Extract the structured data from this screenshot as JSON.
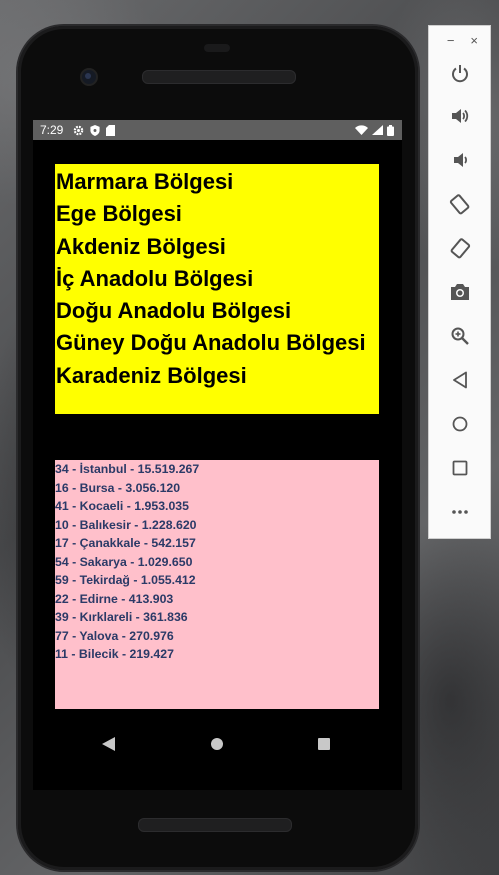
{
  "status_bar": {
    "time": "7:29",
    "left_icons": [
      "gear-icon",
      "shield-icon",
      "sd-card-icon"
    ],
    "right_icons": [
      "wifi-icon",
      "signal-icon",
      "battery-icon"
    ],
    "background": "#5f5f5f"
  },
  "regions": {
    "background": "#ffff00",
    "items": [
      "Marmara Bölgesi",
      "Ege Bölgesi",
      "Akdeniz Bölgesi",
      "İç Anadolu Bölgesi",
      "Doğu Anadolu Bölgesi",
      "Güney Doğu Anadolu Bölgesi",
      "Karadeniz Bölgesi"
    ]
  },
  "cities": {
    "background": "#ffc0cb",
    "text_color": "#2b3a67",
    "items": [
      "34 - İstanbul - 15.519.267",
      "16 - Bursa - 3.056.120",
      "41 - Kocaeli - 1.953.035",
      "10 - Balıkesir - 1.228.620",
      "17 - Çanakkale - 542.157",
      "54 - Sakarya - 1.029.650",
      "59 - Tekirdağ - 1.055.412",
      "22 - Edirne - 413.903",
      "39 - Kırklareli - 361.836",
      "77 - Yalova - 270.976",
      "11 - Bilecik - 219.427"
    ]
  },
  "navbar": {
    "buttons": [
      "back-icon",
      "home-icon",
      "recents-icon"
    ]
  },
  "emulator_panel": {
    "window_controls": [
      "minimize-icon",
      "close-icon"
    ],
    "minimize_label": "−",
    "close_label": "×",
    "buttons": [
      "power-icon",
      "volume-up-icon",
      "volume-down-icon",
      "rotate-left-icon",
      "rotate-right-icon",
      "camera-icon",
      "zoom-icon",
      "back-icon",
      "home-icon",
      "overview-icon",
      "more-icon"
    ]
  }
}
